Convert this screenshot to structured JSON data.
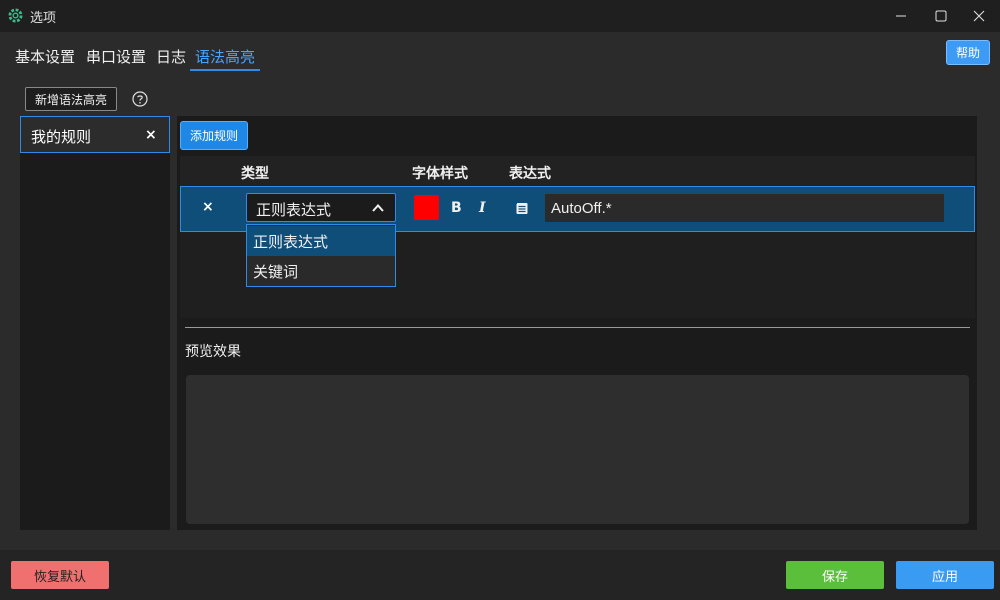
{
  "window": {
    "title": "选项",
    "icon": "gear-icon",
    "controls": [
      "minimize-icon",
      "maximize-icon",
      "close-icon"
    ]
  },
  "tabs": [
    {
      "label": "基本设置",
      "active": false
    },
    {
      "label": "串口设置",
      "active": false
    },
    {
      "label": "日志",
      "active": false
    },
    {
      "label": "语法高亮",
      "active": true
    }
  ],
  "help_button": "帮助",
  "add_highlight_button": "新增语法高亮",
  "highlight_sets": [
    {
      "label": "我的规则",
      "close": "×",
      "selected": true
    }
  ],
  "rules": {
    "add_rule_button": "添加规则",
    "columns": [
      "类型",
      "字体样式",
      "表达式"
    ],
    "rows": [
      {
        "delete": "×",
        "type": "正则表达式",
        "color": "#ff0000",
        "bold_label": "B",
        "italic_label": "I",
        "expression": "AutoOff.*"
      }
    ],
    "type_options": [
      {
        "label": "正则表达式",
        "selected": true
      },
      {
        "label": "关键词",
        "selected": false
      }
    ]
  },
  "preview": {
    "label": "预览效果"
  },
  "footer": {
    "reset_button": "恢复默认",
    "save_button": "保存",
    "apply_button": "应用"
  },
  "colors": {
    "accent": "#2f8ae8",
    "reset": "#f07070",
    "save": "#5bbf3b",
    "apply": "#3a9bf3"
  }
}
